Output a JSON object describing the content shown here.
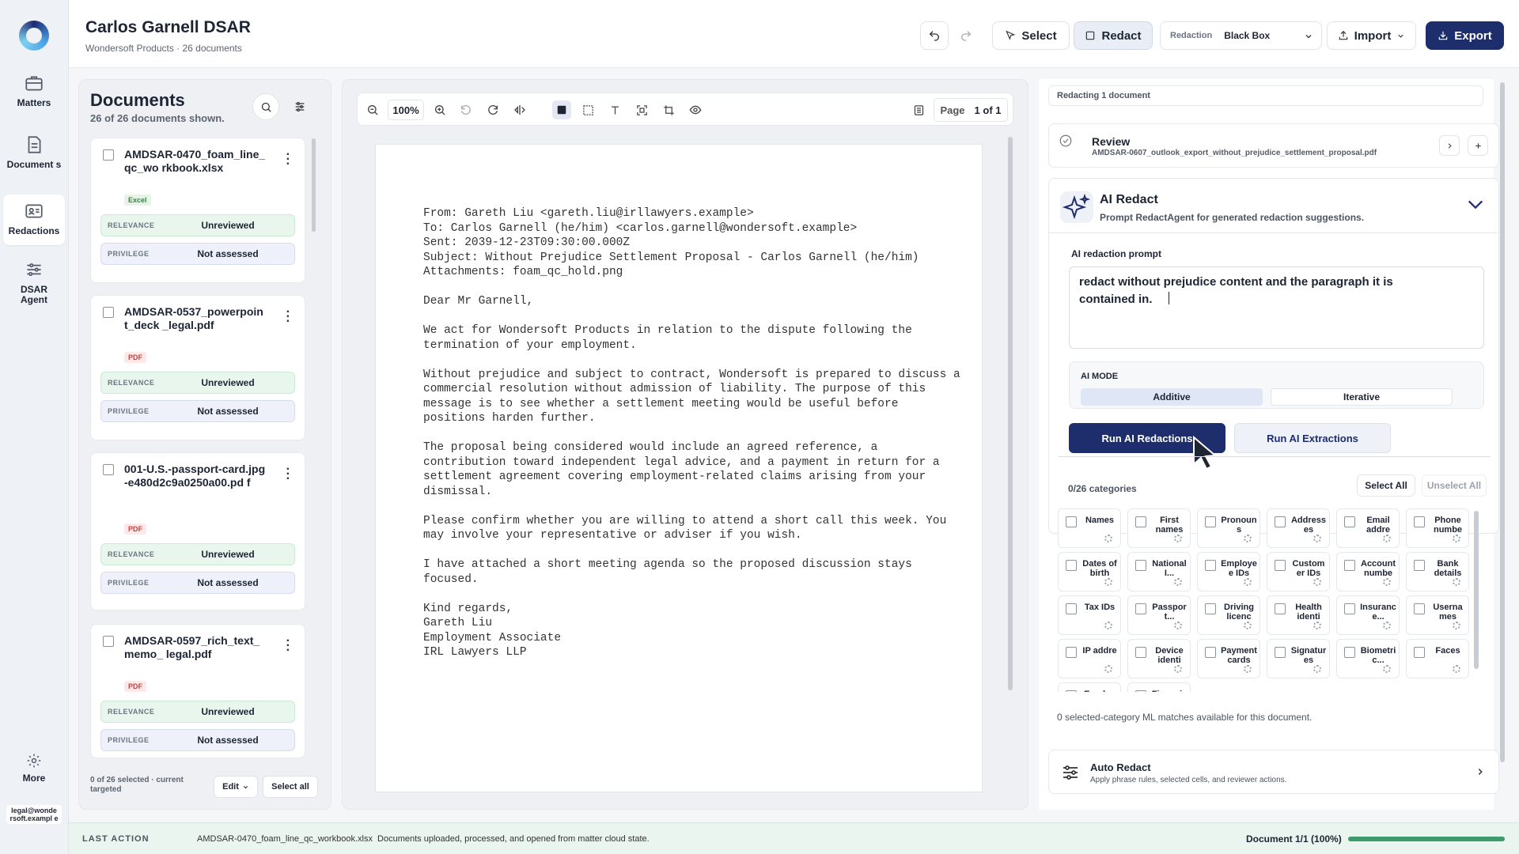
{
  "rail": {
    "items": [
      {
        "label": "Matters",
        "icon": "briefcase-icon"
      },
      {
        "label": "Document s",
        "icon": "document-icon"
      },
      {
        "label": "Redactions",
        "icon": "id-card-icon"
      },
      {
        "label": "DSAR Agent",
        "icon": "sliders-icon"
      }
    ],
    "more_label": "More",
    "user": "legal@wonde rsoft.exampl e"
  },
  "header": {
    "title": "Carlos Garnell DSAR",
    "subtitle": "Wondersoft Products · 26 documents",
    "select_label": "Select",
    "redact_label": "Redact",
    "redaction_label": "Redaction",
    "redaction_value": "Black Box",
    "import_label": "Import",
    "export_label": "Export"
  },
  "documents": {
    "title": "Documents",
    "subtitle": "26 of 26 documents shown.",
    "relevance_label": "RELEVANCE",
    "privilege_label": "PRIVILEGE",
    "items": [
      {
        "name": "AMDSAR-0470_foam_line_qc_wo rkbook.xlsx",
        "tag": "Excel",
        "relevance": "Unreviewed",
        "privilege": "Not assessed"
      },
      {
        "name": "AMDSAR-0537_powerpoint_deck _legal.pdf",
        "tag": "PDF",
        "relevance": "Unreviewed",
        "privilege": "Not assessed"
      },
      {
        "name": "001-U.S.-passport-card.jpg-e480d2c9a0250a00.pd f",
        "tag": "PDF",
        "relevance": "Unreviewed",
        "privilege": "Not assessed"
      },
      {
        "name": "AMDSAR-0597_rich_text_memo_ legal.pdf",
        "tag": "PDF",
        "relevance": "Unreviewed",
        "privilege": "Not assessed"
      }
    ],
    "footer_text": "0 of 26 selected · current targeted",
    "edit_label": "Edit",
    "select_all_label": "Select all"
  },
  "viewer": {
    "zoom": "100%",
    "page_label": "Page",
    "page_value": "1 of 1",
    "email_lines": [
      "From: Gareth Liu <gareth.liu@irllawyers.example>",
      "To: Carlos Garnell (he/him) <carlos.garnell@wondersoft.example>",
      "Sent: 2039-12-23T09:30:00.000Z",
      "Subject: Without Prejudice Settlement Proposal - Carlos Garnell (he/him)",
      "Attachments: foam_qc_hold.png",
      "",
      "Dear Mr Garnell,",
      "",
      "We act for Wondersoft Products in relation to the dispute following the",
      "termination of your employment.",
      "",
      "Without prejudice and subject to contract, Wondersoft is prepared to discuss a",
      "commercial resolution without admission of liability. The purpose of this",
      "message is to see whether a settlement meeting would be useful before",
      "positions harden further.",
      "",
      "The proposal being considered would include an agreed reference, a",
      "contribution toward independent legal advice, and a payment in return for a",
      "settlement agreement covering employment-related claims arising from your",
      "dismissal.",
      "",
      "Please confirm whether you are willing to attend a short call this week. You",
      "may involve your representative or adviser if you wish.",
      "",
      "I have attached a short meeting agenda so the proposed discussion stays",
      "focused.",
      "",
      "Kind regards,",
      "Gareth Liu",
      "Employment Associate",
      "IRL Lawyers LLP"
    ]
  },
  "right": {
    "redacting_label": "Redacting 1 document",
    "review_title": "Review",
    "review_file": "AMDSAR-0607_outlook_export_without_prejudice_settlement_proposal.pdf",
    "ai_title": "AI Redact",
    "ai_subtitle": "Prompt RedactAgent for generated redaction suggestions.",
    "prompt_label": "AI redaction prompt",
    "prompt_value": "redact without prejudice content and the paragraph it is contained in.",
    "mode_label": "AI MODE",
    "mode_additive": "Additive",
    "mode_iterative": "Iterative",
    "run_redactions": "Run AI Redactions",
    "run_extractions": "Run AI Extractions",
    "categories_count": "0/26 categories",
    "select_all": "Select All",
    "unselect_all": "Unselect All",
    "categories": [
      "Names",
      "First names",
      "Pronoun s",
      "Address es",
      "Email addre",
      "Phone numbe",
      "Dates of birth",
      "National I...",
      "Employe e IDs",
      "Custom er IDs",
      "Account numbe",
      "Bank details",
      "Tax IDs",
      "Passpor t...",
      "Driving licenc",
      "Health identi",
      "Insuranc e...",
      "Userna mes",
      "IP addre",
      "Device identi",
      "Payment cards",
      "Signatur es",
      "Biometri c...",
      "Faces",
      "Employ",
      "Financia"
    ],
    "matches_text": "0 selected-category ML matches available for this document.",
    "auto_title": "Auto Redact",
    "auto_subtitle": "Apply phrase rules, selected cells, and reviewer actions."
  },
  "status": {
    "label": "LAST ACTION",
    "text": "AMDSAR-0470_foam_line_qc_workbook.xlsx  Documents uploaded, processed, and opened from matter cloud state.",
    "progress_text": "Document 1/1 (100%)",
    "progress_fraction": 1.0
  }
}
